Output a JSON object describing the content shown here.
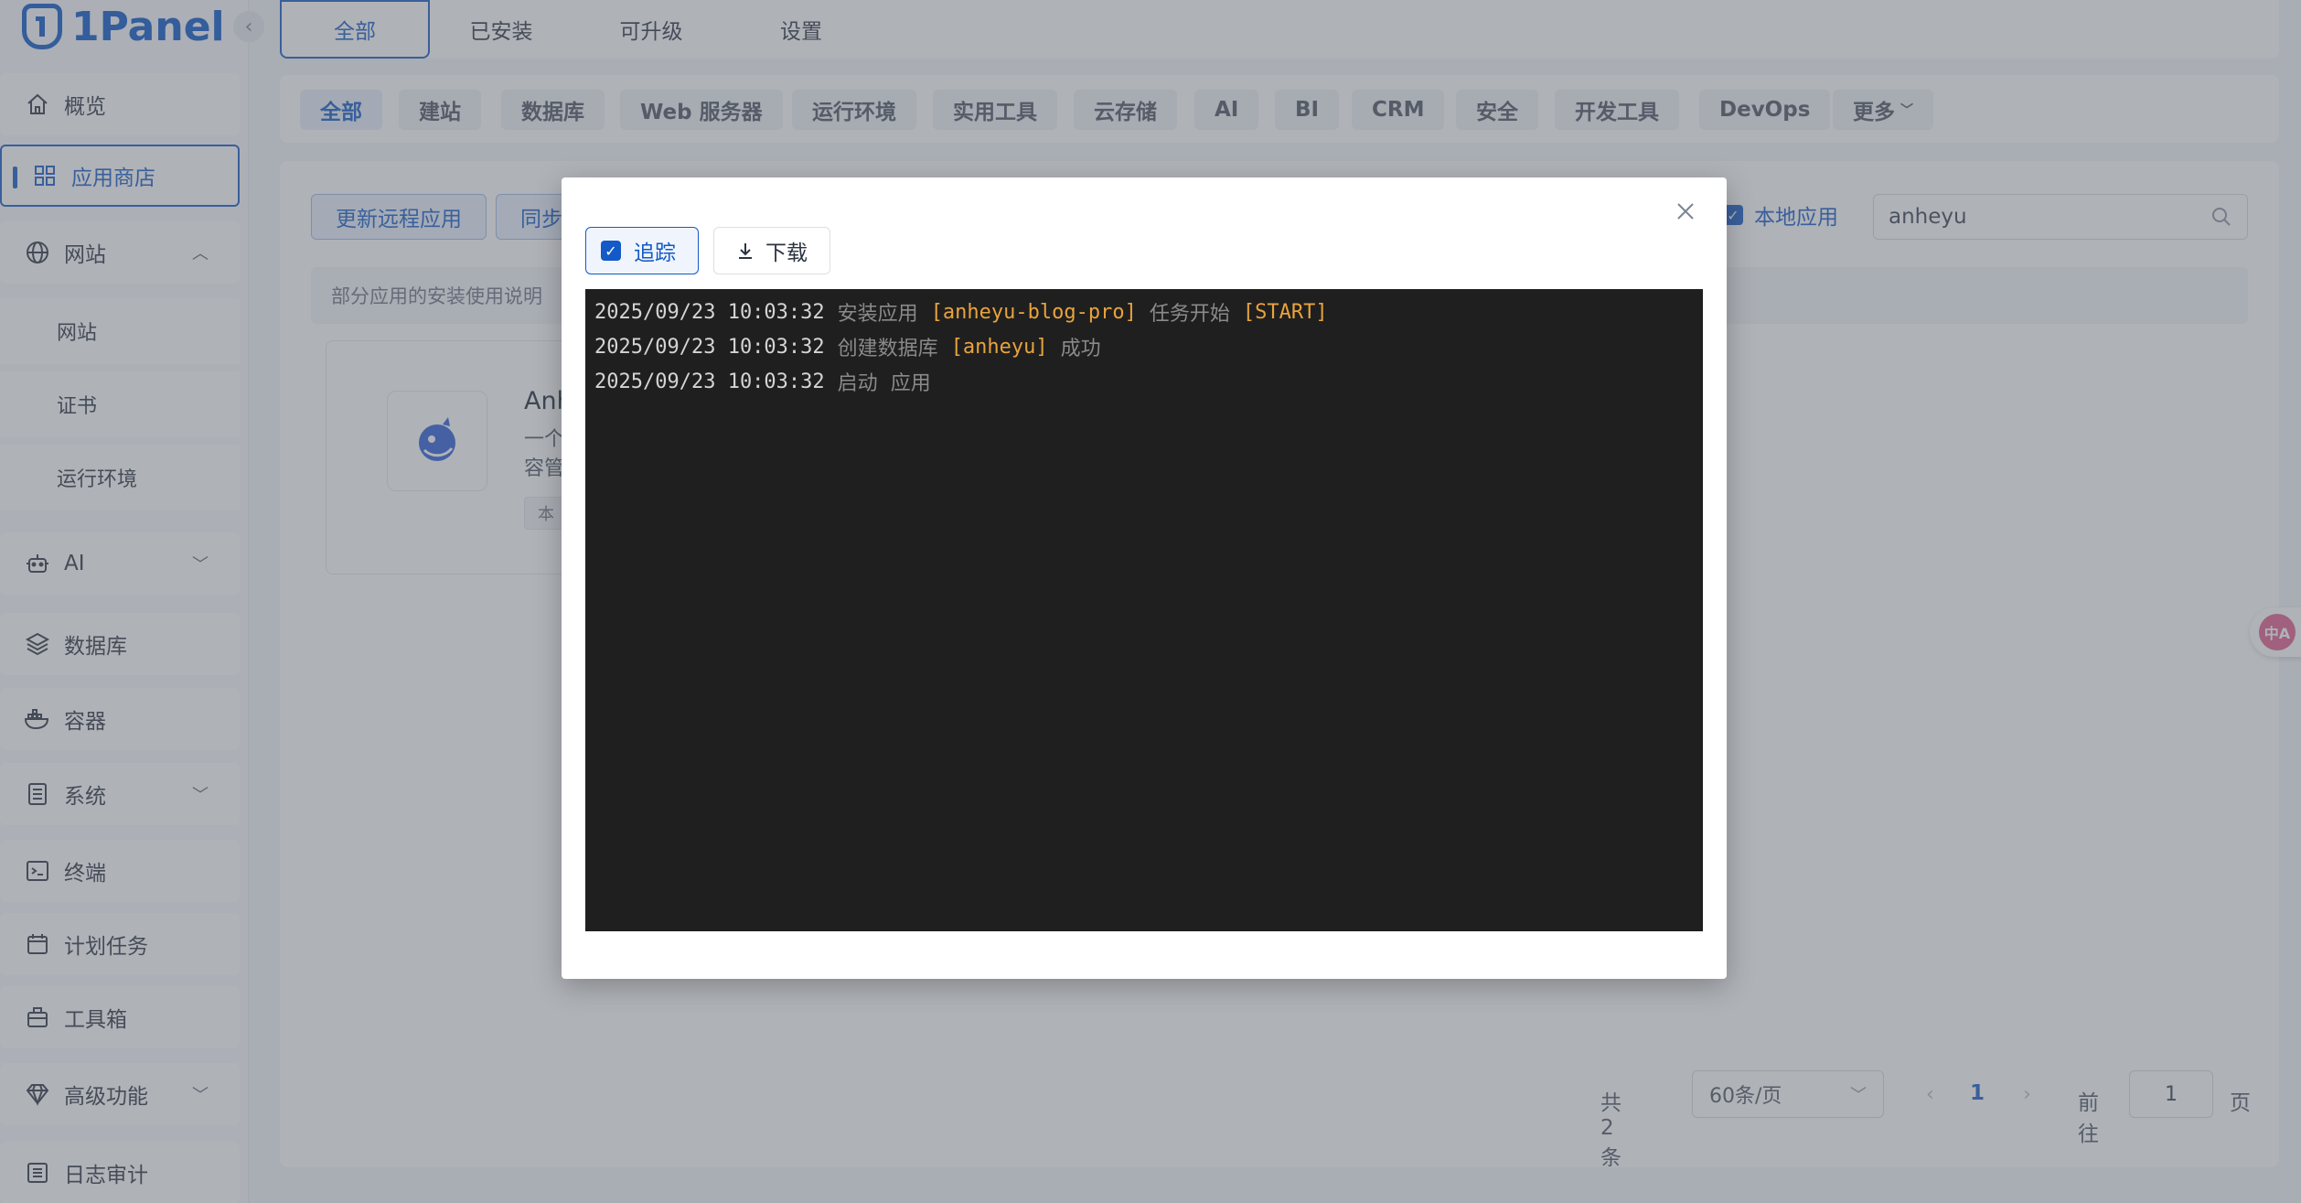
{
  "app": {
    "logo_text": "1Panel"
  },
  "sidebar": {
    "items": [
      {
        "label": "概览"
      },
      {
        "label": "应用商店"
      },
      {
        "label": "网站"
      },
      {
        "label": "网站"
      },
      {
        "label": "证书"
      },
      {
        "label": "运行环境"
      },
      {
        "label": "AI"
      },
      {
        "label": "数据库"
      },
      {
        "label": "容器"
      },
      {
        "label": "系统"
      },
      {
        "label": "终端"
      },
      {
        "label": "计划任务"
      },
      {
        "label": "工具箱"
      },
      {
        "label": "高级功能"
      },
      {
        "label": "日志审计"
      }
    ]
  },
  "top_tabs": [
    {
      "label": "全部"
    },
    {
      "label": "已安装"
    },
    {
      "label": "可升级"
    },
    {
      "label": "设置"
    }
  ],
  "categories": [
    {
      "label": "全部"
    },
    {
      "label": "建站"
    },
    {
      "label": "数据库"
    },
    {
      "label": "Web 服务器"
    },
    {
      "label": "运行环境"
    },
    {
      "label": "实用工具"
    },
    {
      "label": "云存储"
    },
    {
      "label": "AI"
    },
    {
      "label": "BI"
    },
    {
      "label": "CRM"
    },
    {
      "label": "安全"
    },
    {
      "label": "开发工具"
    },
    {
      "label": "DevOps"
    },
    {
      "label": "更多"
    }
  ],
  "toolbar": {
    "update_remote": "更新远程应用",
    "sync_partial": "同步",
    "local_apps": "本地应用",
    "search_value": "anheyu"
  },
  "notice": {
    "text": "部分应用的安装使用说明"
  },
  "card": {
    "name_partial": "Anh",
    "desc_line1": "一个",
    "desc_line2": "容管",
    "tag_partial": "本"
  },
  "pagination": {
    "total": "共 2 条",
    "page_size": "60条/页",
    "current": "1",
    "goto_label": "前往",
    "goto_value": "1",
    "page_suffix": "页"
  },
  "float_button": {
    "label": "中A"
  },
  "modal": {
    "follow_label": "追踪",
    "download_label": "下载",
    "log_lines": [
      {
        "ts": "2025/09/23 10:03:32",
        "parts": [
          {
            "text": "安装应用",
            "color": "#8a8a8a"
          },
          {
            "text": "[anheyu-blog-pro]",
            "color": "#e8a33d"
          },
          {
            "text": "任务开始",
            "color": "#8a8a8a"
          },
          {
            "text": "[START]",
            "color": "#e8a33d"
          }
        ]
      },
      {
        "ts": "2025/09/23 10:03:32",
        "parts": [
          {
            "text": "创建数据库",
            "color": "#8a8a8a"
          },
          {
            "text": "[anheyu]",
            "color": "#e8a33d"
          },
          {
            "text": "成功",
            "color": "#8a8a8a"
          }
        ]
      },
      {
        "ts": "2025/09/23 10:03:32",
        "parts": [
          {
            "text": "启动",
            "color": "#8a8a8a"
          },
          {
            "text": "应用",
            "color": "#8a8a8a"
          }
        ]
      }
    ]
  },
  "colors": {
    "accent": "#1359c7",
    "log_bg": "#1f1f1f",
    "log_highlight": "#e8a33d"
  }
}
